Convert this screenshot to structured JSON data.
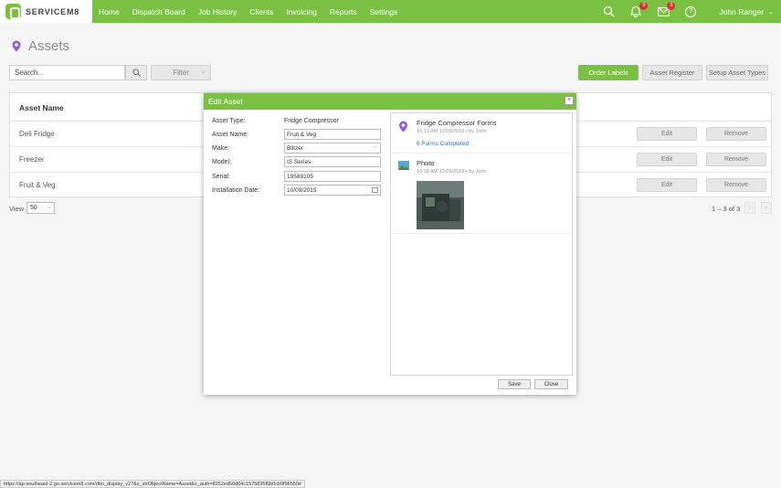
{
  "app": {
    "logo_text": "SERVICEM8",
    "nav": [
      "Home",
      "Dispatch Board",
      "Job History",
      "Clients",
      "Invoicing",
      "Reports",
      "Settings"
    ],
    "notifications_count": "9",
    "messages_count": "3",
    "help_label": "?",
    "user_name": "John Ranger",
    "accent_color": "#7ac143"
  },
  "page": {
    "title": "Assets",
    "search_placeholder": "Search...",
    "filter_label": "Filter",
    "buttons": {
      "order_labels": "Order Labels",
      "asset_register": "Asset Register",
      "setup_asset_types": "Setup Asset Types"
    }
  },
  "table": {
    "header": "Asset Name",
    "rows": [
      {
        "name": "Deli Fridge",
        "edit": "Edit",
        "remove": "Remove"
      },
      {
        "name": "Freezer",
        "edit": "Edit",
        "remove": "Remove"
      },
      {
        "name": "Fruit & Veg",
        "edit": "Edit",
        "remove": "Remove"
      }
    ],
    "view_label": "View",
    "view_value": "50",
    "pager_text": "1 – 3 of 3"
  },
  "modal": {
    "title": "Edit Asset",
    "close_symbol": "×",
    "fields": {
      "asset_type_label": "Asset Type:",
      "asset_type_value": "Fridge Compressor",
      "asset_name_label": "Asset Name:",
      "asset_name_value": "Fruit & Veg",
      "make_label": "Make:",
      "make_value": "Blitzer",
      "model_label": "Model:",
      "model_value": "IS Series",
      "serial_label": "Serial:",
      "serial_value": "19589105",
      "install_label": "Installation Date:",
      "install_value": "10/09/2015"
    },
    "panel": {
      "forms": {
        "title": "Fridge Compressor Forms",
        "meta": "10:19 AM 12/09/2018 •  by John",
        "link": "6 Forms Completed"
      },
      "photo": {
        "title": "Photo",
        "meta": "10:18 AM 12/09/2018 •  by John"
      }
    },
    "save_label": "Save",
    "close_label": "Close"
  },
  "status_url": "https://ap-southeast-2.go.servicem8.com/dbo_display_v2?&s_strObjectName=Asset&s_auth=8252ed50d04c1575835f5b0cb9f96550#"
}
